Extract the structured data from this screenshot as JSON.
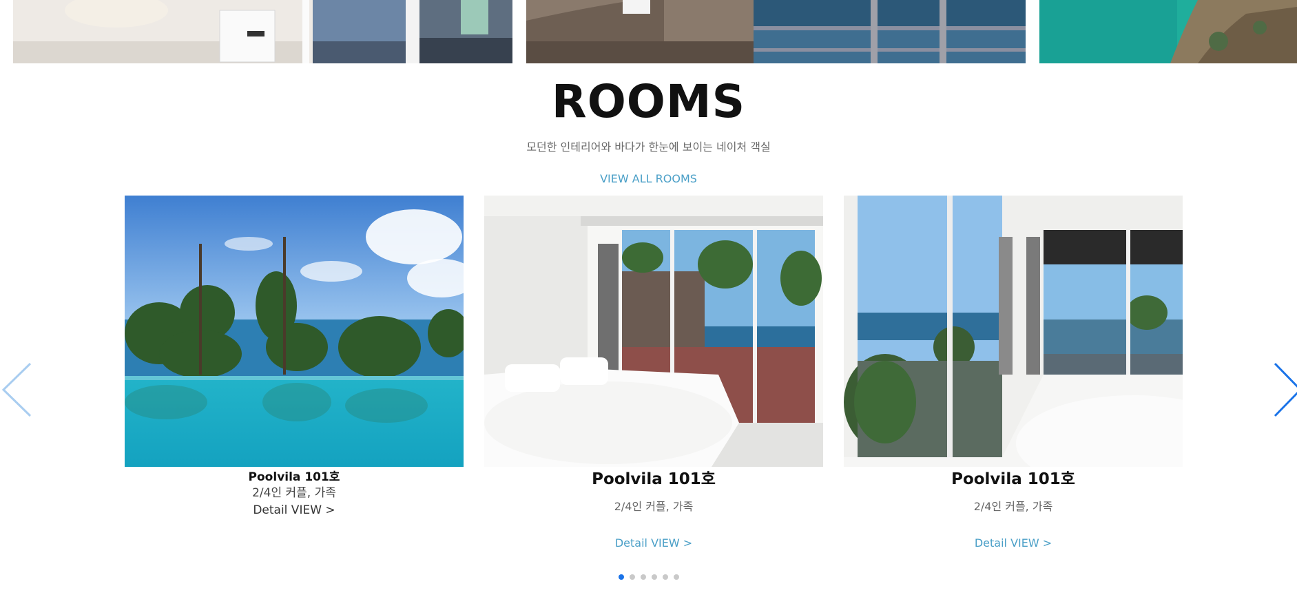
{
  "rooms_section": {
    "title": "ROOMS",
    "subtitle": "모던한 인테리어와 바다가 한눈에 보이는 네이처 객실",
    "view_all_label": "VIEW ALL ROOMS"
  },
  "rooms": [
    {
      "name": "Poolvila 101호",
      "capacity": "2/4인 커플, 가족",
      "detail_label": "Detail VIEW >"
    },
    {
      "name": "Poolvila 101호",
      "capacity": "2/4인 커플, 가족",
      "detail_label": "Detail VIEW >"
    },
    {
      "name": "Poolvila 101호",
      "capacity": "2/4인 커플, 가족",
      "detail_label": "Detail VIEW >"
    }
  ],
  "carousel": {
    "page_count": 6,
    "active_page": 1,
    "prev_icon": "chevron-left-icon",
    "next_icon": "chevron-right-icon"
  },
  "colors": {
    "accent_link": "#4a9fc7",
    "active_dot": "#1a73e8",
    "inactive_dot": "#c9c9c9",
    "arrow_prev": "#a9cdf0",
    "arrow_next": "#1a73e8"
  }
}
